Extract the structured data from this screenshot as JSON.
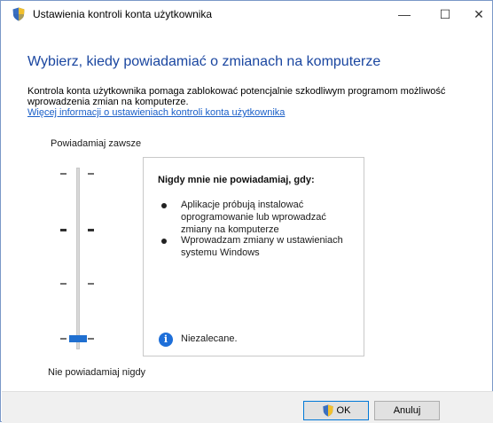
{
  "window": {
    "title": "Ustawienia kontroli konta użytkownika",
    "controls": {
      "minimize": "—",
      "maximize": "☐",
      "close": "✕"
    }
  },
  "main": {
    "heading": "Wybierz, kiedy powiadamiać o zmianach na komputerze",
    "description": "Kontrola konta użytkownika pomaga zablokować potencjalnie szkodliwym programom możliwość wprowadzenia zmian na komputerze.",
    "more_link": "Więcej informacji o ustawieniach kontroli konta użytkownika"
  },
  "slider": {
    "top_label": "Powiadamiaj zawsze",
    "bottom_label": "Nie powiadamiaj nigdy",
    "levels": 4,
    "selected_level": 1,
    "accent_color": "#1f6fd0"
  },
  "info": {
    "title": "Nigdy mnie nie powiadamiaj, gdy:",
    "bullets": [
      "Aplikacje próbują instalować oprogramowanie lub wprowadzać zmiany na komputerze",
      "Wprowadzam zmiany w ustawieniach systemu Windows"
    ],
    "note": "Niezalecane.",
    "note_icon": "info-icon"
  },
  "footer": {
    "ok_label": "OK",
    "cancel_label": "Anuluj"
  }
}
